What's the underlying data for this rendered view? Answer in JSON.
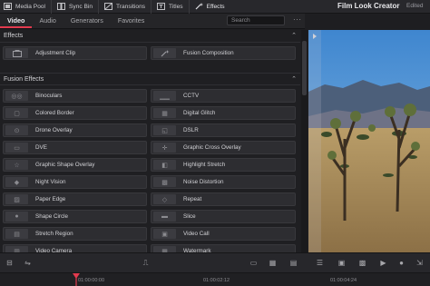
{
  "topbar": {
    "modules": [
      {
        "label": "Media Pool",
        "icon": "media-pool-icon"
      },
      {
        "label": "Sync Bin",
        "icon": "sync-bin-icon"
      },
      {
        "label": "Transitions",
        "icon": "transitions-icon"
      },
      {
        "label": "Titles",
        "icon": "titles-icon"
      },
      {
        "label": "Effects",
        "icon": "effects-wand-icon"
      }
    ],
    "project_title": "Film Look Creator",
    "project_status": "Edited"
  },
  "tabs": [
    "Video",
    "Audio",
    "Generators",
    "Favorites"
  ],
  "active_tab": "Video",
  "search": {
    "placeholder": "Search",
    "value": ""
  },
  "effects_section": {
    "label": "Effects",
    "items": [
      {
        "label": "Adjustment Clip"
      },
      {
        "label": "Fusion Composition"
      }
    ]
  },
  "fusion_section": {
    "label": "Fusion Effects",
    "items": [
      {
        "label": "Binoculars",
        "thumb": "binoculars"
      },
      {
        "label": "CCTV",
        "thumb": "cctv"
      },
      {
        "label": "Colored Border",
        "thumb": "border"
      },
      {
        "label": "Digital Glitch",
        "thumb": "glitch"
      },
      {
        "label": "Drone Overlay",
        "thumb": "drone"
      },
      {
        "label": "DSLR",
        "thumb": "dslr"
      },
      {
        "label": "DVE",
        "thumb": "dve"
      },
      {
        "label": "Graphic Cross Overlay",
        "thumb": "cross"
      },
      {
        "label": "Graphic Shape Overlay",
        "thumb": "star"
      },
      {
        "label": "Highlight Stretch",
        "thumb": "stretch"
      },
      {
        "label": "Night Vision",
        "thumb": "night"
      },
      {
        "label": "Noise Distortion",
        "thumb": "noise"
      },
      {
        "label": "Paper Edge",
        "thumb": "paper"
      },
      {
        "label": "Repeat",
        "thumb": "repeat"
      },
      {
        "label": "Shape Circle",
        "thumb": "circle"
      },
      {
        "label": "Slice",
        "thumb": "slice"
      },
      {
        "label": "Stretch Region",
        "thumb": "region"
      },
      {
        "label": "Video Call",
        "thumb": "call"
      },
      {
        "label": "Video Camera",
        "thumb": "camera"
      },
      {
        "label": "Watermark",
        "thumb": "watermark"
      }
    ]
  },
  "timeline": {
    "timecodes": [
      "01:00:00:00",
      "01:00:02:12",
      "01:00:04:24"
    ]
  },
  "colors": {
    "accent": "#e23a4e",
    "panel": "#1f1f22",
    "item": "#2d2d31"
  }
}
